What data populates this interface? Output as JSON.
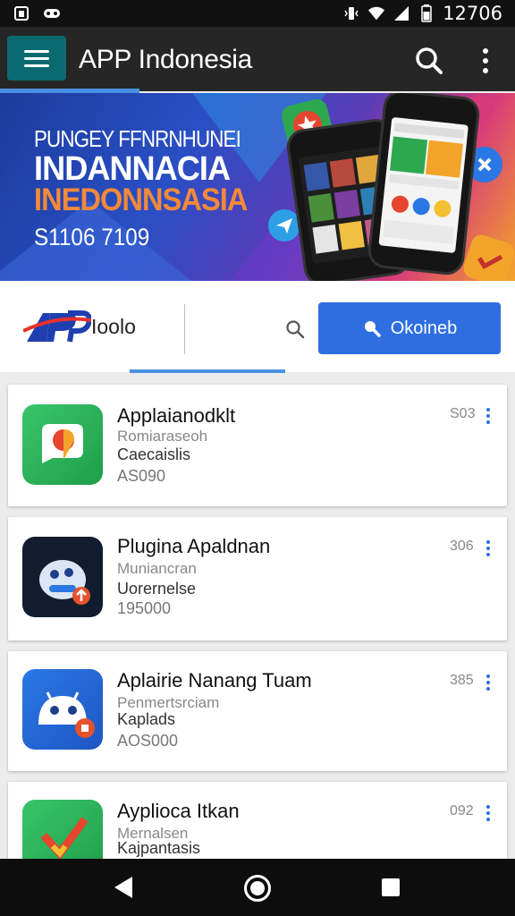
{
  "status_bar": {
    "time": "12706",
    "icons": [
      "notification-icon",
      "game-icon",
      "vibrate-icon",
      "wifi-icon",
      "signal-icon",
      "battery-icon"
    ]
  },
  "app_bar": {
    "title": "APP Indonesia",
    "icons": [
      "menu-icon",
      "search-icon",
      "more-vert-icon"
    ]
  },
  "banner": {
    "line1": "PUNGEY FFNRNHUNEI",
    "line2": "INDANNACIA",
    "line3": "INEDONNSASIA",
    "line4": "S1106 7109"
  },
  "filter_bar": {
    "logo_text": "APP",
    "label": "Ioolo",
    "button_label": "Okoineb"
  },
  "apps": [
    {
      "title": "Applaianodklt",
      "subtitle": "Romiaraseoh",
      "category": "Caecaislis",
      "price": "AS090",
      "count": "S03"
    },
    {
      "title": "Plugina Apaldnan",
      "subtitle": "Muniancran",
      "category": "Uorernelse",
      "price": "195000",
      "count": "306"
    },
    {
      "title": "Aplairie Nanang Tuam",
      "subtitle": "Penmertsrciam",
      "category": "Kaplads",
      "price": "AOS000",
      "count": "385"
    },
    {
      "title": "Ayplioca Itkan",
      "subtitle": "Mernalsen",
      "category": "Kajpantasis",
      "price": "",
      "count": "092"
    }
  ],
  "colors": {
    "app_bar": "#262626",
    "menu_button": "#0b6a6f",
    "accent_blue": "#2f6ee0",
    "banner_orange": "#f38a3a"
  },
  "nav_bar": {
    "icons": [
      "back-icon",
      "home-icon",
      "recents-icon"
    ]
  }
}
